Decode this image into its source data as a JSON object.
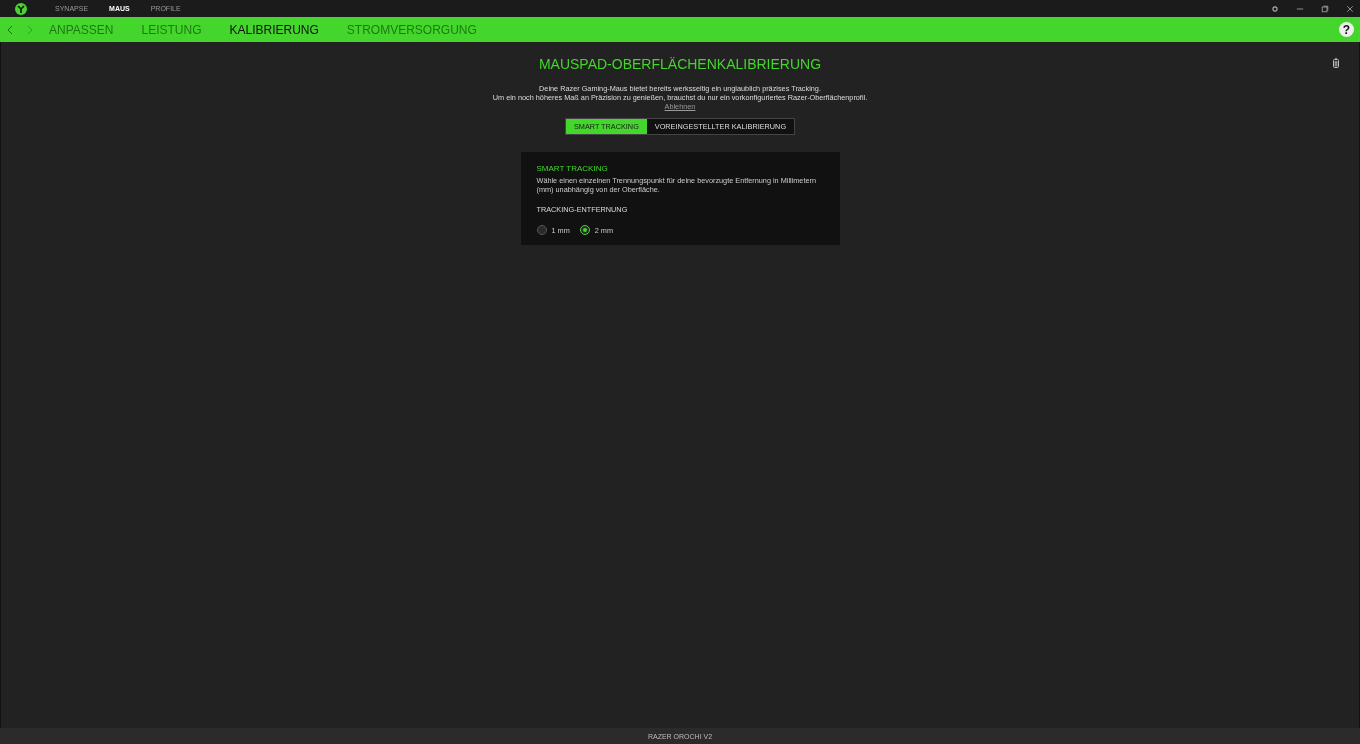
{
  "top_tabs": [
    {
      "label": "SYNAPSE",
      "selected": false
    },
    {
      "label": "MAUS",
      "selected": true
    },
    {
      "label": "PROFILE",
      "selected": false
    }
  ],
  "sub_tabs": [
    {
      "label": "ANPASSEN",
      "selected": false
    },
    {
      "label": "LEISTUNG",
      "selected": false
    },
    {
      "label": "KALIBRIERUNG",
      "selected": true
    },
    {
      "label": "STROMVERSORGUNG",
      "selected": false
    }
  ],
  "help": "?",
  "title": "MAUSPAD-OBERFLÄCHENKALIBRIERUNG",
  "description": [
    "Deine Razer Gaming-Maus bietet bereits werksseitig ein unglaublich präzises Tracking.",
    "Um ein noch höheres Maß an Präzision zu genießen, brauchst du nur ein vorkonfiguriertes Razer-Oberflächenprofil."
  ],
  "dismiss_link": "Ablehnen",
  "mode_toggle": [
    {
      "label": "SMART TRACKING",
      "selected": true
    },
    {
      "label": "VOREINGESTELLTER KALIBRIERUNG",
      "selected": false
    }
  ],
  "card": {
    "heading": "SMART TRACKING",
    "text": "Wähle einen einzelnen Trennungspunkt für deine bevorzugte Entfernung in Millimetern (mm) unabhängig von der Oberfläche.",
    "label": "TRACKING-ENTFERNUNG",
    "options": [
      {
        "label": "1 mm",
        "selected": false
      },
      {
        "label": "2 mm",
        "selected": true
      }
    ]
  },
  "status_bar": {
    "device": "RAZER OROCHI V2"
  }
}
